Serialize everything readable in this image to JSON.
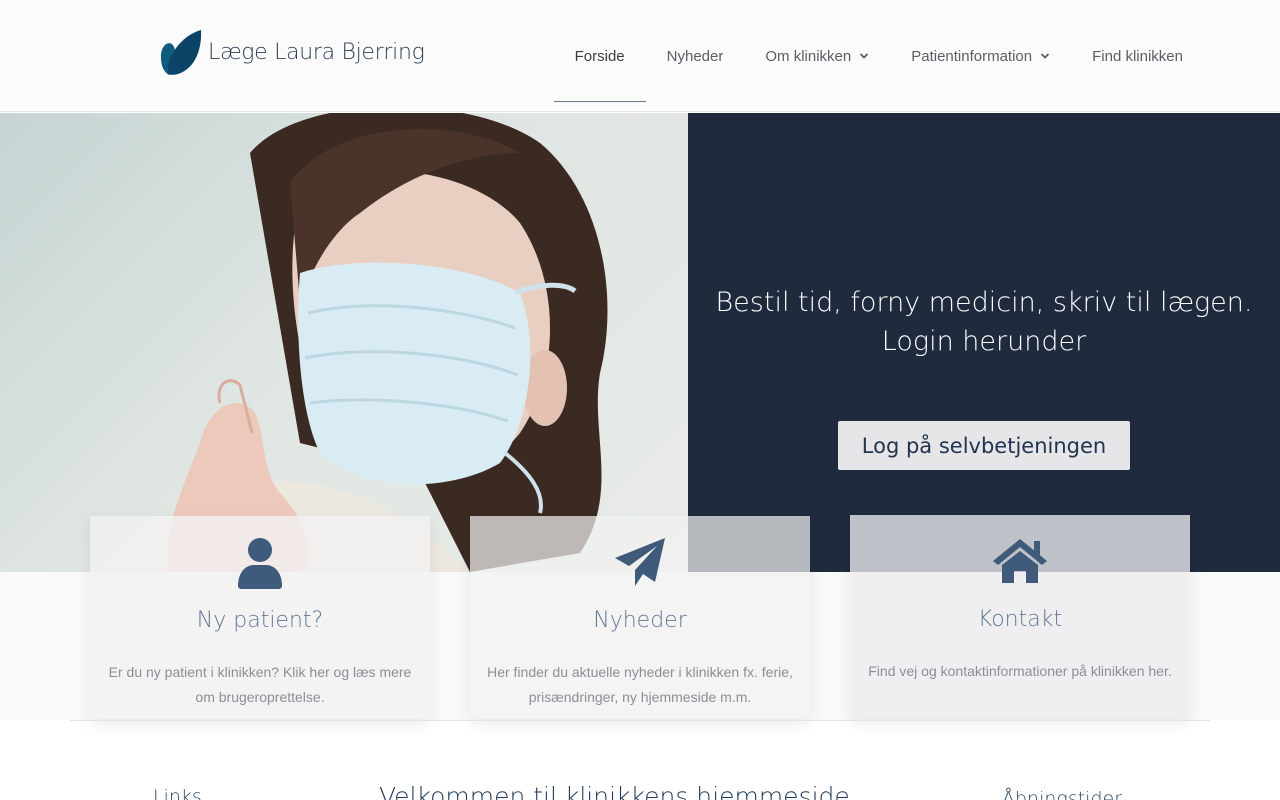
{
  "header": {
    "logo_text": "Læge Laura Bjerring",
    "nav": [
      {
        "label": "Forside",
        "active": true,
        "has_dropdown": false
      },
      {
        "label": "Nyheder",
        "active": false,
        "has_dropdown": false
      },
      {
        "label": "Om klinikken",
        "active": false,
        "has_dropdown": true
      },
      {
        "label": "Patientinformation",
        "active": false,
        "has_dropdown": true
      },
      {
        "label": "Find klinikken",
        "active": false,
        "has_dropdown": false
      }
    ]
  },
  "hero": {
    "headline_line1": "Bestil tid, forny medicin, skriv til lægen.",
    "headline_line2": "Login herunder",
    "button_label": "Log på selvbetjeningen",
    "photo_icon": "woman-with-face-mask-photo"
  },
  "cards": [
    {
      "icon": "user-icon",
      "title": "Ny patient?",
      "text": "Er du ny patient i klinikken? Klik her og læs mere om brugeroprettelse."
    },
    {
      "icon": "paper-plane-icon",
      "title": "Nyheder",
      "text": "Her finder du aktuelle nyheder i klinikken fx. ferie, prisændringer, ny hjemmeside m.m."
    },
    {
      "icon": "home-icon",
      "title": "Kontakt",
      "text": "Find vej og kontaktinformationer på klinikken her."
    }
  ],
  "footer_preview": {
    "links_heading": "Links",
    "welcome_heading": "Velkommen til klinikkens hjemmeside",
    "hours_heading": "Åbningstider"
  },
  "colors": {
    "accent_dark": "#1f2b3d",
    "icon_blue": "#3f5a7a",
    "logo_leaf": "#0f4a6e"
  }
}
